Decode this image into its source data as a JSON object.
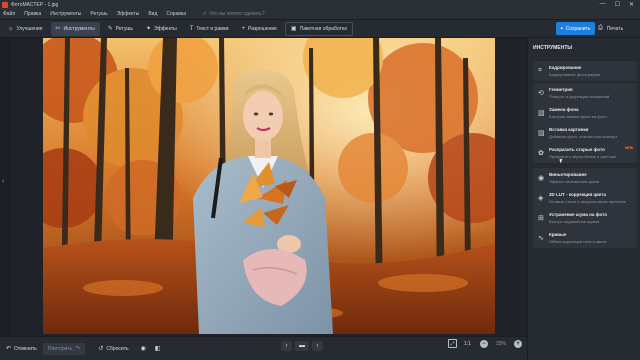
{
  "window": {
    "title": "ФотоМАСТЕР - 1.jpg",
    "controls": [
      "—",
      "☐",
      "✕"
    ]
  },
  "menu": {
    "items": [
      "Файл",
      "Правка",
      "Инструменты",
      "Ретушь",
      "Эффекты",
      "Вид",
      "Справка"
    ],
    "search_placeholder": "Что вы хотите сделать?"
  },
  "toolbar": {
    "tabs": [
      {
        "label": "Улучшение",
        "icon": "adjust-icon",
        "glyph": "☼"
      },
      {
        "label": "Инструменты",
        "icon": "tools-icon",
        "glyph": "✂"
      },
      {
        "label": "Ретушь",
        "icon": "retouch-icon",
        "glyph": "✎"
      },
      {
        "label": "Эффекты",
        "icon": "effects-icon",
        "glyph": "✦"
      },
      {
        "label": "Текст и рамки",
        "icon": "text-icon",
        "glyph": "T"
      },
      {
        "label": "Разрешение",
        "icon": "resolution-icon",
        "glyph": "+"
      },
      {
        "label": "Пакетная обработка",
        "icon": "batch-icon",
        "glyph": "▣"
      }
    ],
    "active_tab": "Инструменты",
    "save_label": "Сохранить",
    "print_label": "Печать"
  },
  "panel": {
    "title": "ИНСТРУМЕНТЫ",
    "tools": [
      {
        "name": "Кадрирование",
        "desc": "Кадрирование фотографии",
        "glyph": "⌗"
      },
      {
        "name": "Геометрия",
        "desc": "Поворот и коррекция искажений",
        "glyph": "⟲"
      },
      {
        "name": "Замена фона",
        "desc": "Быстрая замена фона на фото",
        "glyph": "▧"
      },
      {
        "name": "Вставка картинки",
        "desc": "Добавьте фото, логотип или клипарт",
        "glyph": "▨"
      },
      {
        "name": "Раскрасить старые фото",
        "desc": "Превратить чёрно-белые в цветные",
        "glyph": "✿",
        "badge": "NEW"
      },
      {
        "name": "Виньетирование",
        "desc": "Эффект затемнения краев",
        "glyph": "◉"
      },
      {
        "name": "3D LUT - коррекция цвета",
        "desc": "Готовые стили и загрузка своих пресетов",
        "glyph": "◈"
      },
      {
        "name": "Устранение шума на фото",
        "desc": "Быстро подавление шумов",
        "glyph": "⊞"
      },
      {
        "name": "Кривые",
        "desc": "Гибкая коррекция тона и цвета",
        "glyph": "∿"
      }
    ]
  },
  "bottom": {
    "undo_label": "Отменить",
    "redo_label": "Повторить",
    "reset_label": "Сбросить",
    "ratio_label": "1:1",
    "zoom_value": "33%"
  },
  "colors": {
    "accent": "#1f7fe0",
    "panel_bg": "#262a31",
    "badge": "#ff7a2f"
  }
}
